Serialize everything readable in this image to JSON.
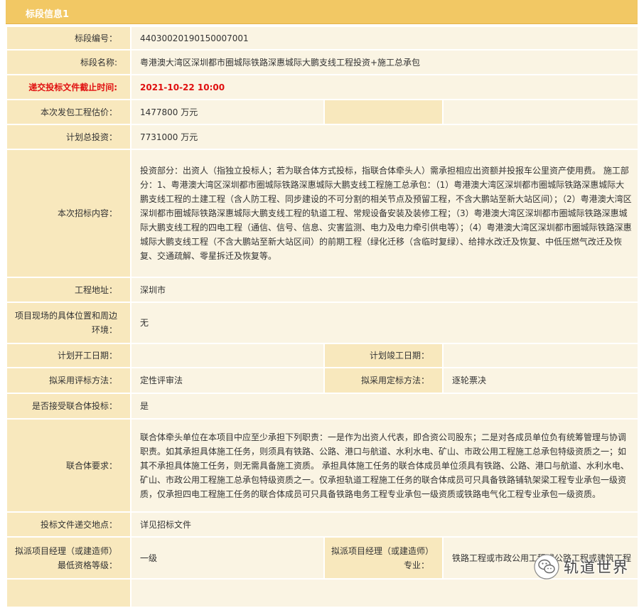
{
  "header": {
    "title": "标段信息1"
  },
  "rows": {
    "section_no": {
      "label": "标段编号：",
      "value": "44030020190150007001"
    },
    "section_name": {
      "label": "标段名称:",
      "value": "粤港澳大湾区深圳都市圈城际铁路深惠城际大鹏支线工程投资+施工总承包"
    },
    "deadline": {
      "label": "递交投标文件截止时间:",
      "value": "2021-10-22 10:00"
    },
    "est_price": {
      "label": "本次发包工程估价：",
      "value": "1477800 万元"
    },
    "total_invest": {
      "label": "计划总投资：",
      "value": "7731000 万元"
    },
    "content": {
      "label": "本次招标内容：",
      "value": "投资部分：出资人（指独立投标人；若为联合体方式投标，指联合体牵头人）需承担相应出资额并投报车公里资产使用费。 施工部分：1、粤港澳大湾区深圳都市圈城际铁路深惠城际大鹏支线工程施工总承包：（1）粤港澳大湾区深圳都市圈城际铁路深惠城际大鹏支线工程的土建工程（含人防工程、同步建设的不可分割的相关节点及预留工程，不含大鹏站至新大站区间）；（2）粤港澳大湾区深圳都市圈城际铁路深惠城际大鹏支线工程的轨道工程、常规设备安装及装修工程；（3）粤港澳大湾区深圳都市圈城际铁路深惠城际大鹏支线工程的四电工程（通信、信号、信息、灾害监测、电力及电力牵引供电等）；（4）粤港澳大湾区深圳都市圈城际铁路深惠城际大鹏支线工程（不含大鹏站至新大站区间）的前期工程（绿化迁移（含临时复绿）、给排水改迁及恢复、中低压燃气改迁及恢复、交通疏解、零星拆迁及恢复等。"
    },
    "address": {
      "label": "工程地址：",
      "value": "深圳市"
    },
    "location": {
      "label": "项目现场的具体位置和周边环境：",
      "value": "无"
    },
    "start_date": {
      "label": "计划开工日期：",
      "value": ""
    },
    "end_date": {
      "label": "计划竣工日期：",
      "value": ""
    },
    "eval_method": {
      "label": "拟采用评标方法：",
      "value": "定性评审法"
    },
    "bid_method": {
      "label": "拟采用定标方法：",
      "value": "逐轮票决"
    },
    "consortium_accept": {
      "label": "是否接受联合体投标：",
      "value": "是"
    },
    "consortium_req": {
      "label": "联合体要求：",
      "value": "联合体牵头单位在本项目中应至少承担下列职责：一是作为出资人代表，即合资公司股东；二是对各成员单位负有统筹管理与协调职责。如其承担具体施工任务，则须具有铁路、公路、港口与航道、水利水电、矿山、市政公用工程施工总承包特级资质之一；如其不承担具体施工任务，则无需具备施工资质。 承担具体施工任务的联合体成员单位须具有铁路、公路、港口与航道、水利水电、矿山、市政公用工程施工总承包特级资质之一。仅承担轨道工程施工任务的联合体成员可只具备铁路铺轨架梁工程专业承包一级资质，仅承担四电工程施工任务的联合体成员可只具备铁路电务工程专业承包一级资质或铁路电气化工程专业承包一级资质。"
    },
    "submit_place": {
      "label": "投标文件递交地点：",
      "value": "详见招标文件"
    },
    "pm_grade": {
      "label": "拟派项目经理（或建造师）最低资格等级：",
      "value": "一级"
    },
    "pm_major": {
      "label": "拟派项目经理（或建造师）专业：",
      "value": "铁路工程或市政公用工程或公路工程或建筑工程"
    }
  },
  "watermark": {
    "text": "轨道世界",
    "icon": "wechat-icon"
  },
  "colors": {
    "header": "#f2c864",
    "label_bg": "#f8e8bd",
    "value_bg": "#faf4e3",
    "red": "#e01010"
  }
}
